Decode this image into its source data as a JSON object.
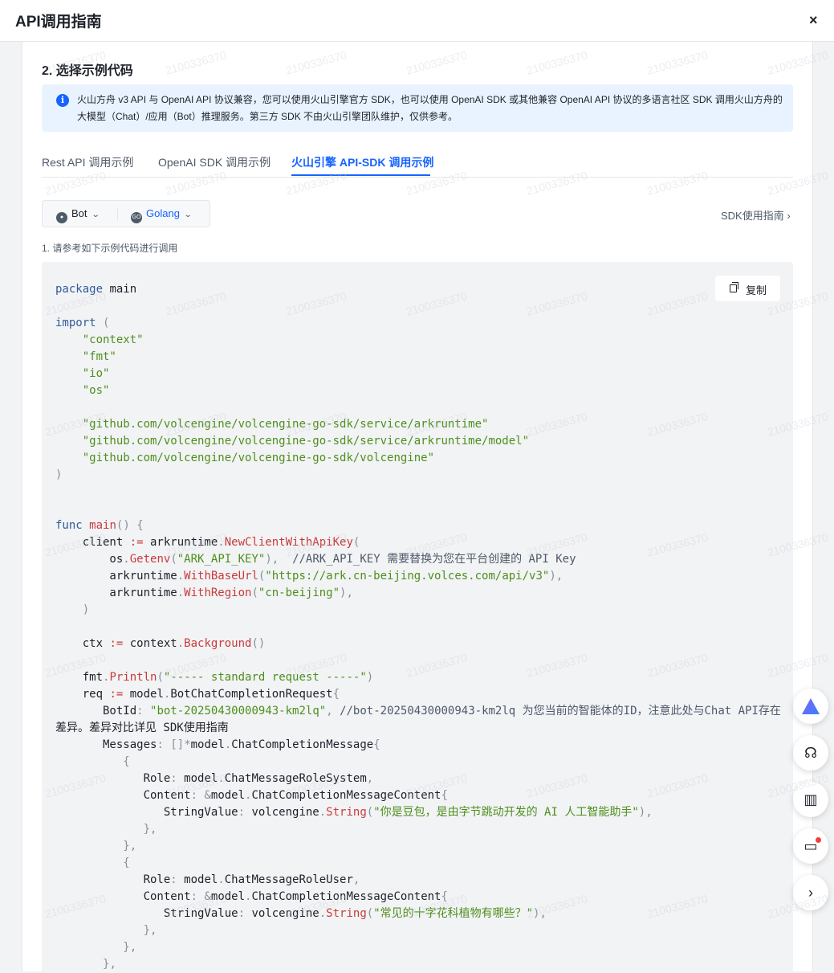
{
  "window": {
    "title": "API调用指南",
    "close_symbol": "×"
  },
  "section": {
    "title": "2. 选择示例代码"
  },
  "notice": {
    "icon": "info-icon",
    "text": "火山方舟 v3 API 与 OpenAI API 协议兼容，您可以使用火山引擎官方 SDK，也可以使用 OpenAI SDK 或其他兼容 OpenAI API 协议的多语言社区 SDK 调用火山方舟的大模型（Chat）/应用（Bot）推理服务。第三方 SDK 不由火山引擎团队维护，仅供参考。"
  },
  "tabs": [
    {
      "label": "Rest API 调用示例",
      "active": false
    },
    {
      "label": "OpenAI SDK 调用示例",
      "active": false
    },
    {
      "label": "火山引擎 API-SDK 调用示例",
      "active": true
    }
  ],
  "selector": {
    "type": {
      "value": "Bot",
      "icon": "bot-icon"
    },
    "language": {
      "value": "Golang",
      "icon": "go-icon"
    }
  },
  "sdk_link": {
    "label": "SDK使用指南",
    "icon": "chevron-right-icon"
  },
  "step": {
    "text": "1. 请参考如下示例代码进行调用"
  },
  "copy_button": {
    "label": "复制",
    "icon": "copy-icon"
  },
  "code": {
    "language": "go",
    "text": "package main\n\nimport (\n    \"context\"\n    \"fmt\"\n    \"io\"\n    \"os\"\n\n    \"github.com/volcengine/volcengine-go-sdk/service/arkruntime\"\n    \"github.com/volcengine/volcengine-go-sdk/service/arkruntime/model\"\n    \"github.com/volcengine/volcengine-go-sdk/volcengine\"\n)\n\n\nfunc main() {\n    client := arkruntime.NewClientWithApiKey(\n        os.Getenv(\"ARK_API_KEY\"),  //ARK_API_KEY 需要替换为您在平台创建的 API Key\n        arkruntime.WithBaseUrl(\"https://ark.cn-beijing.volces.com/api/v3\"),\n        arkruntime.WithRegion(\"cn-beijing\"),\n    )\n\n    ctx := context.Background()\n\n    fmt.Println(\"----- standard request -----\")\n    req := model.BotChatCompletionRequest{\n       BotId: \"bot-20250430000943-km2lq\", //bot-20250430000943-km2lq 为您当前的智能体的ID，注意此处与Chat API存在\n差异。差异对比详见 SDK使用指南\n       Messages: []*model.ChatCompletionMessage{\n          {\n             Role: model.ChatMessageRoleSystem,\n             Content: &model.ChatCompletionMessageContent{\n                StringValue: volcengine.String(\"你是豆包，是由字节跳动开发的 AI 人工智能助手\"),\n             },\n          },\n          {\n             Role: model.ChatMessageRoleUser,\n             Content: &model.ChatCompletionMessageContent{\n                StringValue: volcengine.String(\"常见的十字花科植物有哪些？\"),\n             },\n          },\n       },"
  },
  "floating_buttons": [
    {
      "name": "ai-assistant-icon"
    },
    {
      "name": "support-headset-icon"
    },
    {
      "name": "docs-book-icon"
    },
    {
      "name": "feedback-message-icon",
      "badge": true
    },
    {
      "name": "chevron-right-icon"
    }
  ],
  "watermark": {
    "text": "2100336370"
  },
  "colors": {
    "accent": "#1664ff",
    "notice_bg": "#e8f3ff",
    "code_bg": "#f2f3f5"
  }
}
